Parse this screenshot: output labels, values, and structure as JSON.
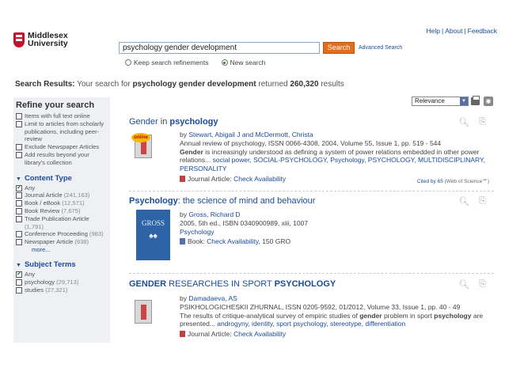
{
  "header": {
    "logo_line1": "Middlesex",
    "logo_line2": "University",
    "links": [
      "Help",
      "About",
      "Feedback"
    ],
    "search_value": "psychology gender development",
    "search_button": "Search",
    "advanced_search": "Advanced Search",
    "radio_keep": "Keep search refinements",
    "radio_new": "New search"
  },
  "results_heading": {
    "label": "Search Results:",
    "prefix": "Your search for",
    "query": "psychology gender development",
    "middle": "returned",
    "count": "260,320",
    "suffix": "results"
  },
  "sidebar": {
    "title": "Refine your search",
    "options": [
      {
        "label": "Items with full text online",
        "checked": false
      },
      {
        "label": "Limit to articles from scholarly publications, including peer-review",
        "checked": false
      },
      {
        "label": "Exclude Newspaper Articles",
        "checked": false
      },
      {
        "label": "Add results beyond your library's collection",
        "checked": false
      }
    ],
    "content_type_title": "Content Type",
    "content_types": [
      {
        "label": "Any",
        "count": "",
        "checked": true
      },
      {
        "label": "Journal Article",
        "count": "(241,163)",
        "checked": false
      },
      {
        "label": "Book / eBook",
        "count": "(12,571)",
        "checked": false
      },
      {
        "label": "Book Review",
        "count": "(7,675)",
        "checked": false
      },
      {
        "label": "Trade Publication Article",
        "count": "(1,791)",
        "checked": false
      },
      {
        "label": "Conference Proceeding",
        "count": "(983)",
        "checked": false
      },
      {
        "label": "Newspaper Article",
        "count": "(938)",
        "checked": false
      }
    ],
    "more": "more...",
    "subject_terms_title": "Subject Terms",
    "subject_terms": [
      {
        "label": "Any",
        "count": "",
        "checked": true
      },
      {
        "label": "psychology",
        "count": "(29,713)",
        "checked": false
      },
      {
        "label": "studies",
        "count": "(27,321)",
        "checked": false
      }
    ]
  },
  "toolbar": {
    "sort_value": "Relevance"
  },
  "results": [
    {
      "title_a": "Gender",
      "title_b": " in ",
      "title_c": "psychology",
      "badge": "online",
      "by": "by",
      "authors": "Stewart, Abigail J and McDermott, Christa",
      "source": "Annual review of psychology, ISSN 0066-4308, 2004, Volume 55, Issue 1, pp. 519 - 544",
      "snippet_bold": "Gender",
      "snippet": " is increasingly understood as defining a system of power relations embedded in other power relations...",
      "subjects": "social power, SOCIAL-PSYCHOLOGY, Psychology, PSYCHOLOGY, MULTIDISCIPLINARY, PERSONALITY",
      "format": "Journal Article:",
      "availability": "Check Availability",
      "cited": "Cited by 65",
      "cited_source": "(Web of Science℠)"
    },
    {
      "title_a": "Psychology",
      "title_b": ": the science of mind and behaviour",
      "by": "by",
      "authors": "Gross, Richard D",
      "source": "2005, 5th ed., ISBN 0340900989, xiii, 1007",
      "subject": "Psychology",
      "cover_text": "GROSS",
      "format": "Book:",
      "availability": "Check Availability",
      "callno": ", 150 GRO"
    },
    {
      "title_a": "GENDER",
      "title_b": " RESEARCHES IN SPORT ",
      "title_c": "PSYCHOLOGY",
      "by": "by",
      "authors": "Damadaeva, AS",
      "source": "PSIKHOLOGICHESKII ZHURNAL, ISSN 0205-9592, 01/2012, Volume 33, Issue 1, pp. 40 - 49",
      "snippet_pre": "The results of critique-analytical survey of empiric studies of ",
      "snippet_bold1": "gender",
      "snippet_mid": " problem in sport ",
      "snippet_bold2": "psychology",
      "snippet_post": " are presented...",
      "subjects": "androgyny, identity, sport psychology, stereotype, differentiation",
      "format": "Journal Article:",
      "availability": "Check Availability"
    }
  ]
}
